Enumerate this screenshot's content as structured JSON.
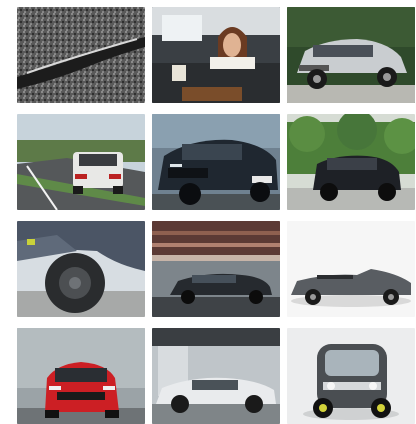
{
  "gallery": {
    "tiles": [
      {
        "subject": "tyre-tread-closeup"
      },
      {
        "subject": "woman-in-camper-van"
      },
      {
        "subject": "silver-suv-front"
      },
      {
        "subject": "white-suv-rear-on-road"
      },
      {
        "subject": "dark-suv-front"
      },
      {
        "subject": "black-suv-trees"
      },
      {
        "subject": "offroad-tyre-closeup"
      },
      {
        "subject": "dark-sedan-motion-blur"
      },
      {
        "subject": "grey-convertible"
      },
      {
        "subject": "red-hatchback"
      },
      {
        "subject": "white-sedan-side"
      },
      {
        "subject": "small-microcar-front"
      }
    ]
  }
}
